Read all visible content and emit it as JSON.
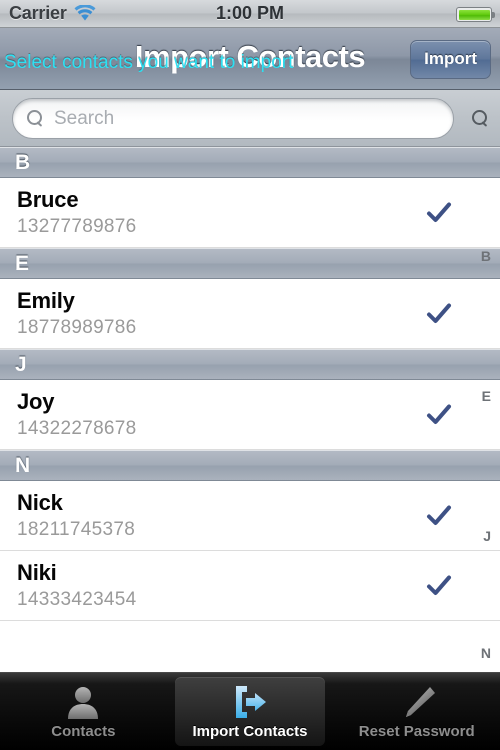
{
  "status_bar": {
    "carrier": "Carrier",
    "time": "1:00 PM",
    "wifi_icon": "wifi-icon",
    "battery_icon": "battery-full-icon"
  },
  "nav_bar": {
    "title": "Import Contacts",
    "right_button": "Import",
    "subtitle": "Select contacts you want to import",
    "subtitle_color": "#2ee0f2"
  },
  "search": {
    "placeholder": "Search",
    "value": "",
    "icon": "search-icon",
    "right_icon": "search-icon"
  },
  "list": {
    "sections": [
      {
        "letter": "B",
        "contacts": [
          {
            "name": "Bruce",
            "phone": "13277789876",
            "selected": true
          }
        ]
      },
      {
        "letter": "E",
        "contacts": [
          {
            "name": "Emily",
            "phone": "18778989786",
            "selected": true
          }
        ]
      },
      {
        "letter": "J",
        "contacts": [
          {
            "name": "Joy",
            "phone": "14322278678",
            "selected": true
          }
        ]
      },
      {
        "letter": "N",
        "contacts": [
          {
            "name": "Nick",
            "phone": "18211745378",
            "selected": true
          },
          {
            "name": "Niki",
            "phone": "14333423454",
            "selected": true
          }
        ]
      }
    ],
    "index_letters": [
      "B",
      "E",
      "J",
      "N"
    ],
    "checkmark_color": "#3e5185"
  },
  "tab_bar": {
    "tabs": [
      {
        "label": "Contacts",
        "icon": "person-icon",
        "selected": false
      },
      {
        "label": "Import Contacts",
        "icon": "import-arrow-icon",
        "selected": true
      },
      {
        "label": "Reset Password",
        "icon": "pencil-icon",
        "selected": false
      }
    ]
  }
}
